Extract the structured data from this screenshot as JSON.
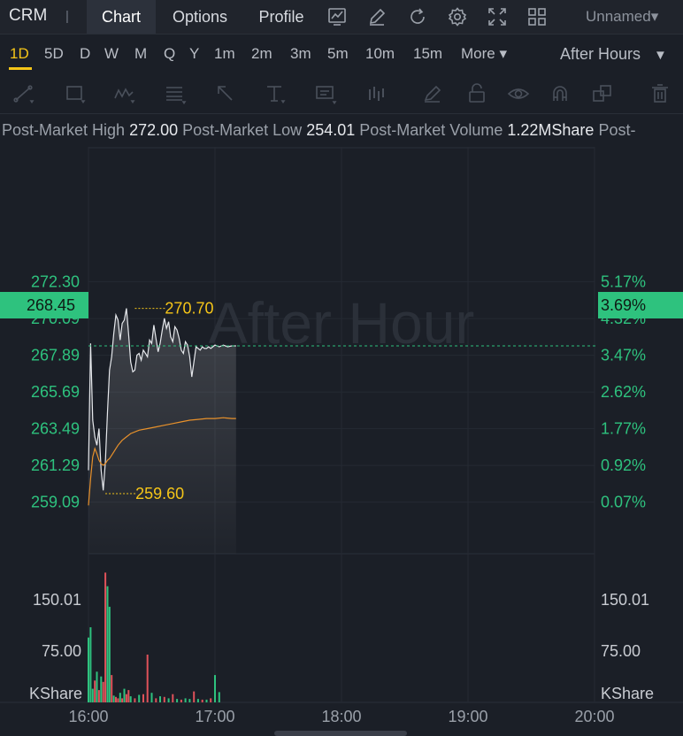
{
  "header": {
    "ticker": "CRM",
    "separator": "|",
    "tabs": [
      {
        "label": "Chart",
        "active": true
      },
      {
        "label": "Options",
        "active": false
      },
      {
        "label": "Profile",
        "active": false
      }
    ],
    "icons": [
      "indicator-icon",
      "draw-pen-icon",
      "refresh-icon",
      "settings-gear-icon",
      "fullscreen-icon",
      "layout-grid-icon"
    ],
    "layout_name": "Unnamed"
  },
  "timeframes": {
    "items": [
      "1D",
      "5D",
      "D",
      "W",
      "M",
      "Q",
      "Y",
      "1m",
      "2m",
      "3m",
      "5m",
      "10m",
      "15m"
    ],
    "active": "1D",
    "more_label": "More",
    "session_label": "After Hours"
  },
  "drawing_tools": [
    "trend-line-icon",
    "rectangle-icon",
    "pattern-icon",
    "fib-icon",
    "arrow-icon",
    "text-icon",
    "annotation-icon",
    "bar-pattern-icon",
    "brush-icon",
    "lock-icon",
    "eye-icon",
    "magnet-icon",
    "layers-icon",
    "trash-icon"
  ],
  "stats": {
    "high_label": "Post-Market High",
    "high_value": "272.00",
    "low_label": "Post-Market Low",
    "low_value": "254.01",
    "volume_label": "Post-Market Volume",
    "volume_value": "1.22MShare",
    "extra_label": "Post-"
  },
  "watermark": "After Hour",
  "current": {
    "price": "268.45",
    "change_pct": "3.69%"
  },
  "colors": {
    "up": "#2ec27e",
    "down": "#e0525a",
    "price_line": "#e6e8ec",
    "avg_line": "#e8912b",
    "highlight": "#f5c518",
    "grid": "#2a2f38"
  },
  "chart_data": {
    "type": "line",
    "price_axis": {
      "ticks": [
        "272.30",
        "270.09",
        "267.89",
        "265.69",
        "263.49",
        "261.29",
        "259.09"
      ],
      "tick_values": [
        272.3,
        270.09,
        267.89,
        265.69,
        263.49,
        261.29,
        259.09
      ],
      "ylim": [
        256.0,
        275.5
      ]
    },
    "percent_axis": {
      "ticks": [
        "5.17%",
        "4.32%",
        "3.47%",
        "2.62%",
        "1.77%",
        "0.92%",
        "0.07%"
      ]
    },
    "volume_axis": {
      "ticks": [
        "150.01",
        "75.00"
      ],
      "unit": "KShare",
      "ylim": [
        0,
        215
      ]
    },
    "x_axis": {
      "ticks": [
        "16:00",
        "17:00",
        "18:00",
        "19:00",
        "20:00"
      ],
      "tick_values": [
        0,
        60,
        120,
        180,
        240
      ],
      "xlim": [
        0,
        240
      ]
    },
    "annotations": {
      "high": {
        "label": "270.70",
        "value": 270.7,
        "x": 22
      },
      "low": {
        "label": "259.60",
        "value": 259.6,
        "x": 8
      }
    },
    "series": [
      {
        "name": "Price",
        "x": [
          0,
          1,
          2,
          3,
          4,
          5,
          6,
          7,
          8,
          9,
          10,
          11,
          12,
          13,
          14,
          15,
          16,
          17,
          18,
          19,
          20,
          21,
          22,
          23,
          24,
          25,
          26,
          27,
          28,
          29,
          30,
          31,
          32,
          33,
          34,
          35,
          36,
          37,
          38,
          39,
          40,
          41,
          42,
          43,
          44,
          45,
          46,
          47,
          48,
          49,
          50,
          51,
          52,
          53,
          54,
          55,
          56,
          57,
          58,
          59,
          60,
          62,
          64,
          66,
          68,
          70
        ],
        "values": [
          261.0,
          268.6,
          264.0,
          263.0,
          262.5,
          263.5,
          261.0,
          259.8,
          261.5,
          264.5,
          267.0,
          267.8,
          269.2,
          270.3,
          270.0,
          268.8,
          269.8,
          270.0,
          270.7,
          269.2,
          267.5,
          266.9,
          267.0,
          267.9,
          268.0,
          267.6,
          268.2,
          268.0,
          267.8,
          268.8,
          268.6,
          269.7,
          268.9,
          268.1,
          268.6,
          269.4,
          270.1,
          269.5,
          269.9,
          269.0,
          268.7,
          269.6,
          269.4,
          268.9,
          268.2,
          268.0,
          268.7,
          268.5,
          267.8,
          266.6,
          267.5,
          268.4,
          268.3,
          268.2,
          268.4,
          268.3,
          268.3,
          268.4,
          268.3,
          268.4,
          268.5,
          268.4,
          268.5,
          268.4,
          268.45,
          268.45
        ]
      },
      {
        "name": "Average",
        "x": [
          0,
          1,
          2,
          3,
          4,
          5,
          6,
          7,
          8,
          9,
          10,
          12,
          14,
          16,
          18,
          20,
          24,
          28,
          32,
          36,
          40,
          44,
          48,
          52,
          56,
          60,
          64,
          68,
          70
        ],
        "values": [
          258.9,
          260.5,
          261.8,
          262.3,
          262.0,
          261.6,
          261.4,
          261.3,
          261.4,
          261.6,
          261.7,
          262.1,
          262.5,
          262.8,
          263.0,
          263.2,
          263.4,
          263.5,
          263.6,
          263.7,
          263.8,
          263.9,
          264.0,
          264.05,
          264.1,
          264.1,
          264.15,
          264.1,
          264.1
        ]
      }
    ],
    "volume": {
      "x": [
        0,
        1,
        2,
        3,
        4,
        5,
        6,
        7,
        8,
        9,
        10,
        11,
        12,
        13,
        14,
        15,
        16,
        17,
        18,
        19,
        20,
        22,
        24,
        26,
        28,
        30,
        32,
        34,
        36,
        38,
        40,
        42,
        44,
        46,
        48,
        50,
        52,
        54,
        56,
        58,
        60,
        62
      ],
      "values": [
        95,
        110,
        20,
        32,
        45,
        18,
        38,
        30,
        190,
        170,
        140,
        40,
        10,
        8,
        6,
        14,
        6,
        20,
        12,
        18,
        9,
        6,
        11,
        12,
        70,
        14,
        6,
        9,
        8,
        6,
        12,
        5,
        4,
        6,
        5,
        16,
        5,
        4,
        4,
        6,
        40,
        15
      ],
      "up": [
        true,
        true,
        true,
        false,
        true,
        false,
        true,
        false,
        false,
        true,
        true,
        false,
        true,
        false,
        false,
        true,
        false,
        true,
        false,
        false,
        true,
        false,
        true,
        false,
        false,
        true,
        false,
        true,
        false,
        true,
        false,
        true,
        false,
        true,
        true,
        false,
        true,
        false,
        true,
        false,
        true,
        true
      ]
    }
  }
}
